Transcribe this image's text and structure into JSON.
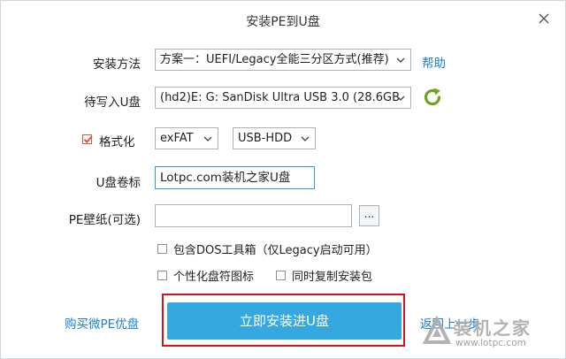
{
  "window": {
    "title": "安装PE到U盘"
  },
  "install_method": {
    "label": "安装方法",
    "value": "方案一：UEFI/Legacy全能三分区方式(推荐)",
    "help_link": "帮助"
  },
  "target_disk": {
    "label": "待写入U盘",
    "value": "(hd2)E: G: SanDisk Ultra USB 3.0 (28.6GB"
  },
  "format": {
    "label": "格式化",
    "checked": true,
    "fs_value": "exFAT",
    "mode_value": "USB-HDD"
  },
  "volume": {
    "label": "U盘卷标",
    "value": "Lotpc.com装机之家U盘"
  },
  "wallpaper": {
    "label": "PE壁纸(可选)",
    "value": "",
    "browse_label": "..."
  },
  "options": {
    "include_dos": "包含DOS工具箱（仅Legacy启动可用）",
    "personalize_icon": "个性化盘符图标",
    "copy_installer": "同时复制安装包"
  },
  "footer": {
    "buy_link": "购买微PE优盘",
    "install_button": "立即安装进U盘",
    "back_link": "返回上一步"
  },
  "watermark": {
    "text": "装机之家",
    "url": "www.lotpc.com"
  },
  "colors": {
    "accent": "#36a8e0",
    "link": "#1a7fd0",
    "highlight": "#d4141c",
    "refresh": "#6aa520"
  },
  "icons": {
    "close": "close-icon",
    "dropdown": "chevron-down-icon",
    "refresh": "refresh-icon"
  }
}
